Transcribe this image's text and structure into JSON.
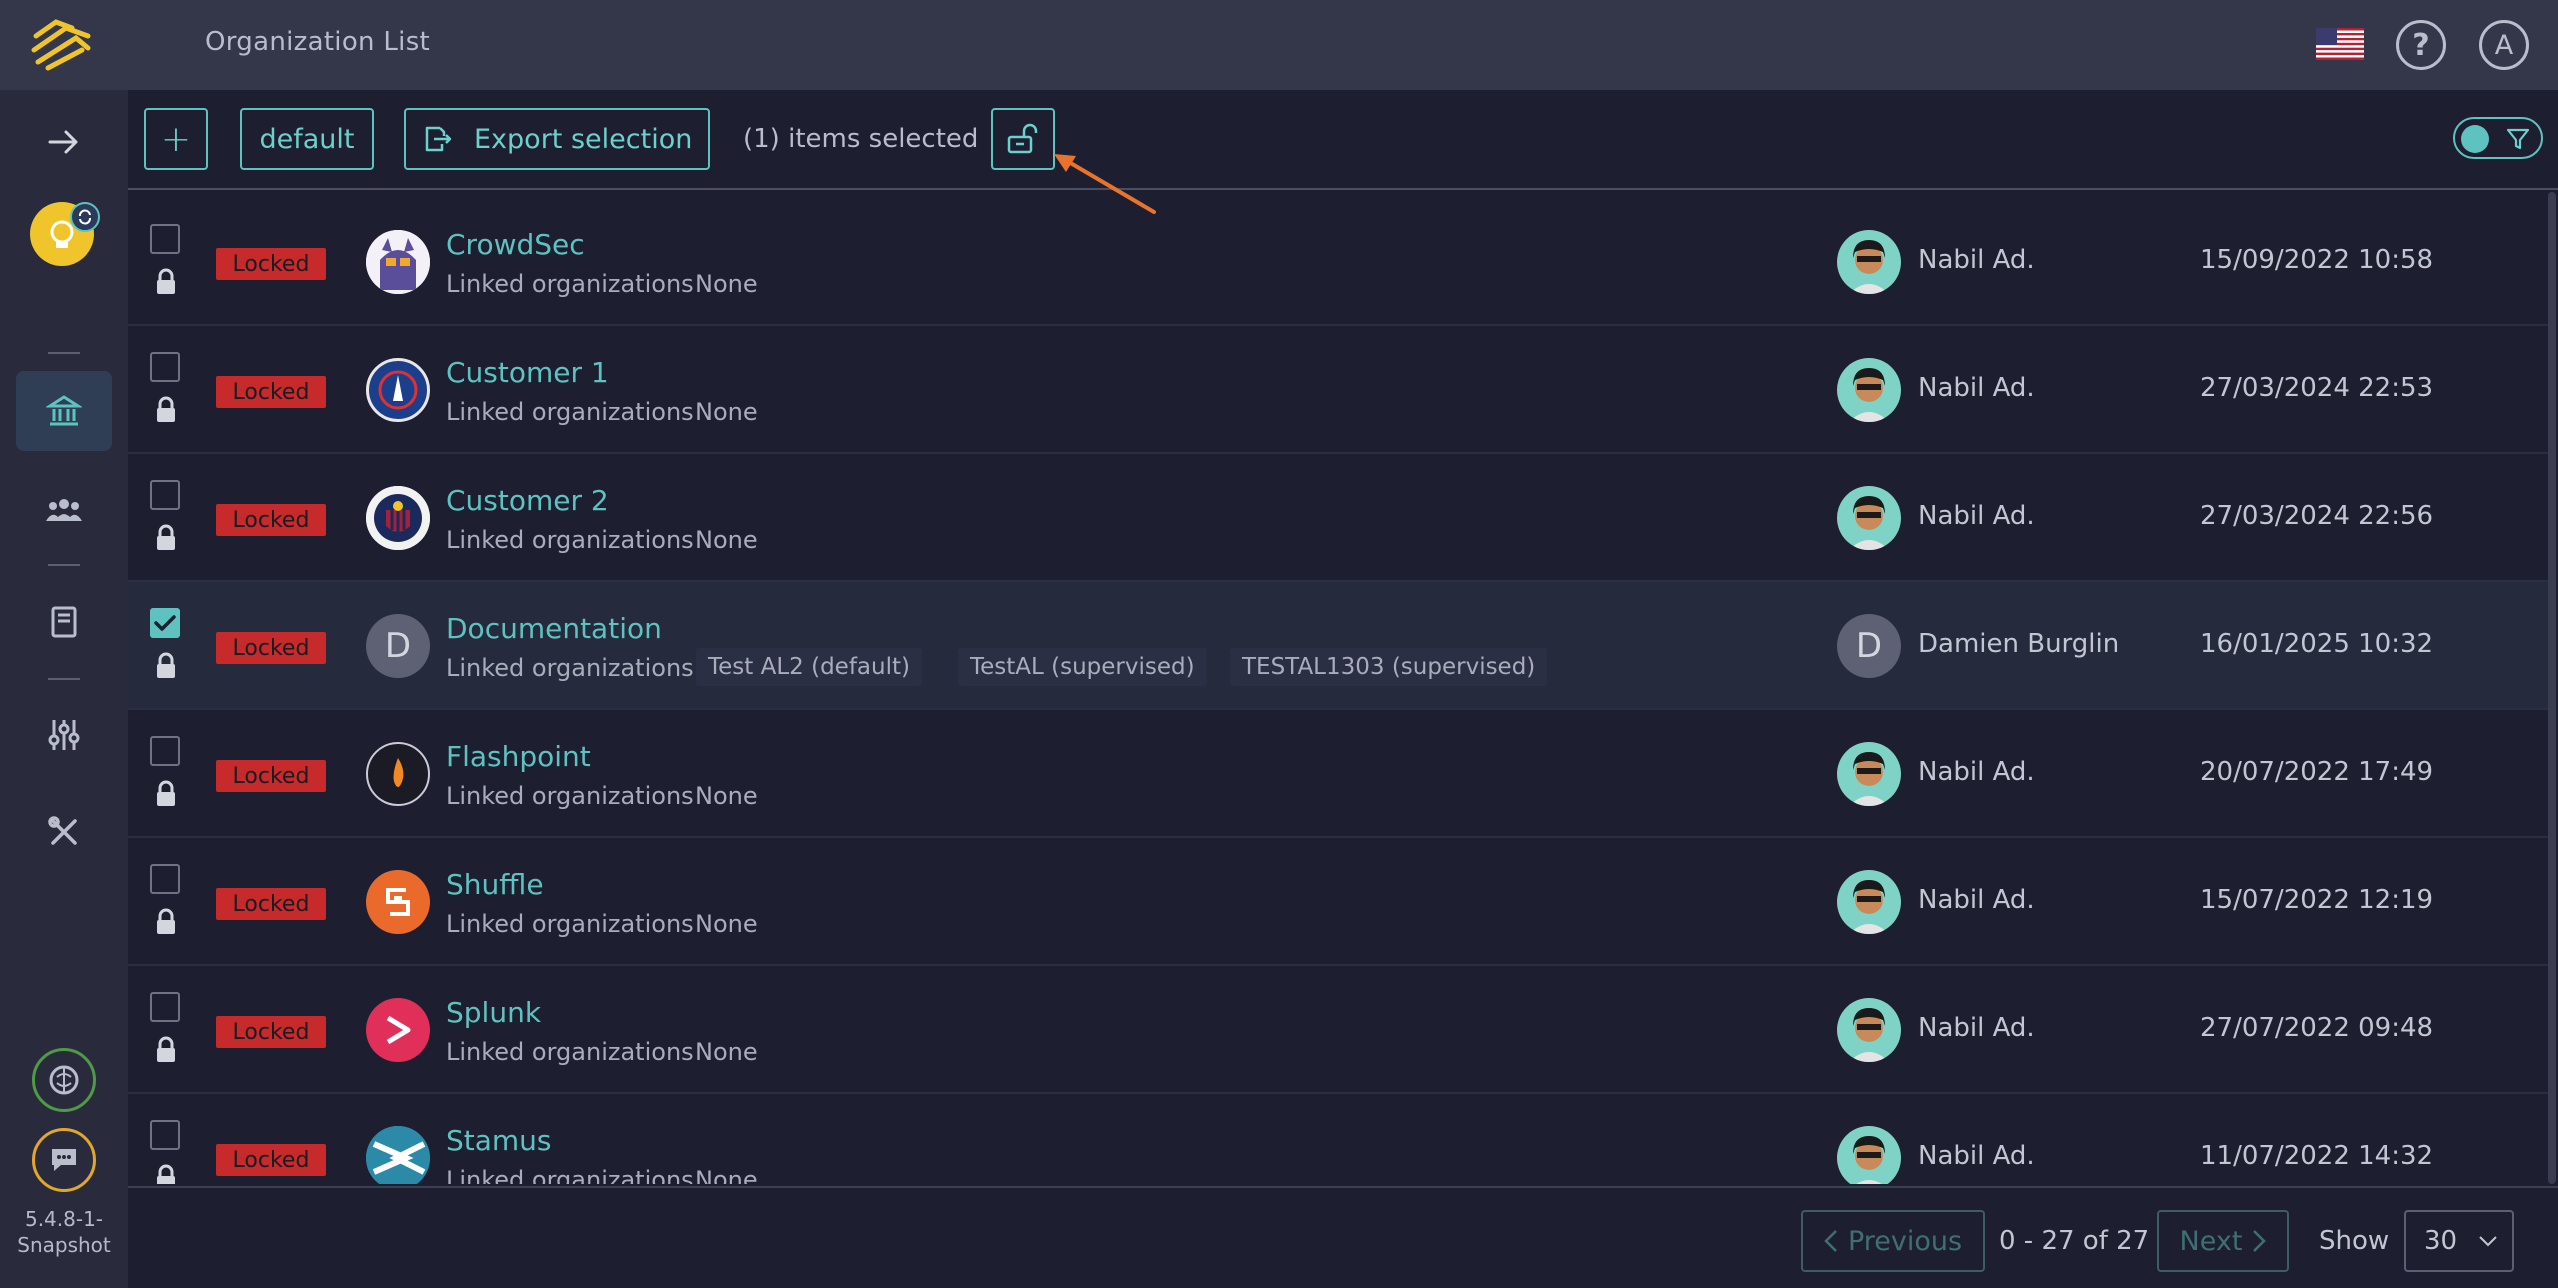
{
  "header": {
    "title": "Organization List",
    "account_initial": "A",
    "help_glyph": "?"
  },
  "sidebar": {
    "version": "5.4.8-1-Snapshot"
  },
  "toolbar": {
    "add_label": "+",
    "default_label": "default",
    "export_label": "Export selection",
    "selection_text": "(1) items selected"
  },
  "rows": [
    {
      "name": "CrowdSec",
      "status": "Locked",
      "linked_label": "Linked organizations",
      "linked": "None",
      "creator": "Nabil Ad.",
      "date": "15/09/2022 10:58",
      "checked": false
    },
    {
      "name": "Customer 1",
      "status": "Locked",
      "linked_label": "Linked organizations",
      "linked": "None",
      "creator": "Nabil Ad.",
      "date": "27/03/2024 22:53",
      "checked": false
    },
    {
      "name": "Customer 2",
      "status": "Locked",
      "linked_label": "Linked organizations",
      "linked": "None",
      "creator": "Nabil Ad.",
      "date": "27/03/2024 22:56",
      "checked": false
    },
    {
      "name": "Documentation",
      "status": "Locked",
      "linked_label": "Linked organizations",
      "linked_chips": [
        "Test AL2 (default)",
        "TestAL (supervised)",
        "TESTAL1303 (supervised)"
      ],
      "logo_letter": "D",
      "creator_letter": "D",
      "creator": "Damien Burglin",
      "date": "16/01/2025 10:32",
      "checked": true
    },
    {
      "name": "Flashpoint",
      "status": "Locked",
      "linked_label": "Linked organizations",
      "linked": "None",
      "creator": "Nabil Ad.",
      "date": "20/07/2022 17:49",
      "checked": false
    },
    {
      "name": "Shuffle",
      "status": "Locked",
      "linked_label": "Linked organizations",
      "linked": "None",
      "creator": "Nabil Ad.",
      "date": "15/07/2022 12:19",
      "checked": false
    },
    {
      "name": "Splunk",
      "status": "Locked",
      "linked_label": "Linked organizations",
      "linked": "None",
      "creator": "Nabil Ad.",
      "date": "27/07/2022 09:48",
      "checked": false
    },
    {
      "name": "Stamus",
      "status": "Locked",
      "linked_label": "Linked organizations",
      "linked": "None",
      "creator": "Nabil Ad.",
      "date": "11/07/2022 14:32",
      "checked": false
    }
  ],
  "pagination": {
    "previous_label": "Previous",
    "next_label": "Next",
    "range": "0 - 27 of 27",
    "show_label": "Show",
    "page_size": "30"
  },
  "colors": {
    "accent": "#5ec2c0",
    "locked_badge": "#c62a2a",
    "annotation_arrow": "#e8732c",
    "header_bg": "#34374a",
    "sidebar_bg": "#292b3c",
    "page_bg": "#1d1f30"
  },
  "icons": {
    "sidebar": [
      "expand-arrow-icon",
      "bot-icon",
      "organization-icon",
      "users-icon",
      "book-icon",
      "sliders-icon",
      "tools-icon",
      "brain-icon",
      "chat-icon"
    ],
    "toolbar": [
      "plus-icon",
      "export-icon",
      "unlock-icon",
      "filter-icon"
    ]
  }
}
